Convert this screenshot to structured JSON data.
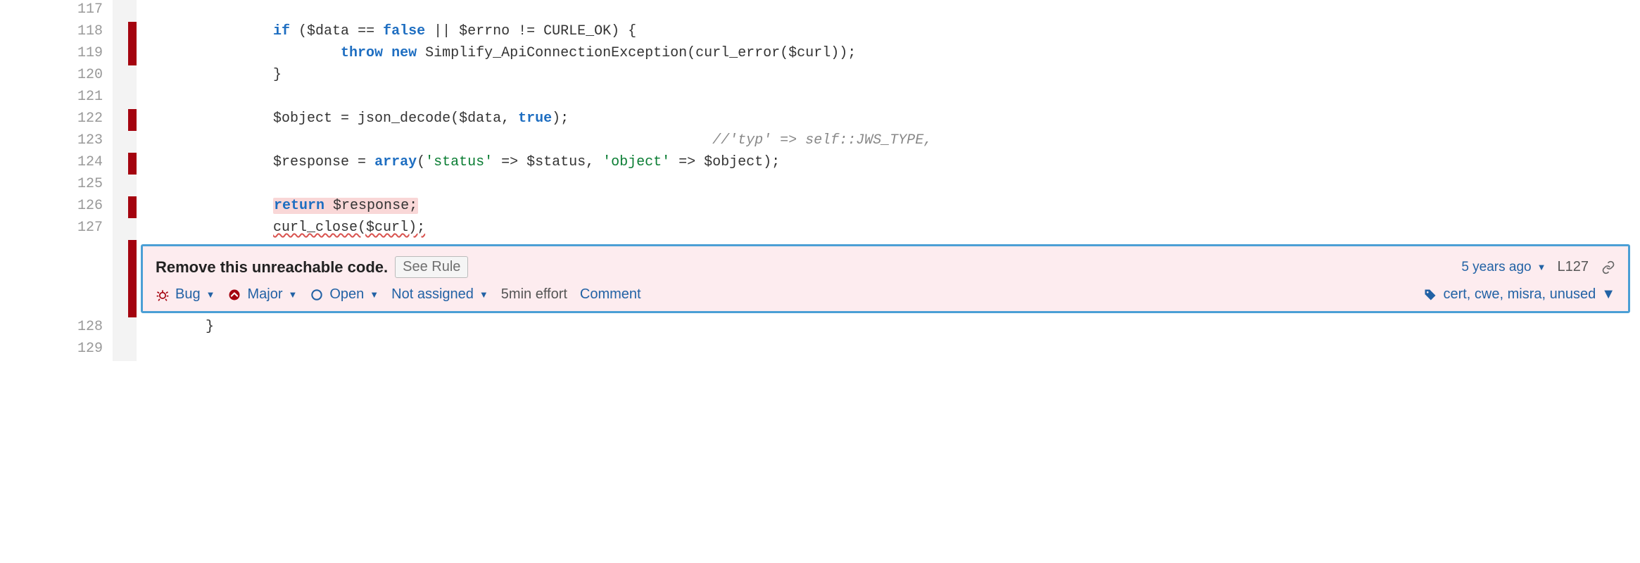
{
  "code_lines": [
    {
      "no": "117",
      "marker": false,
      "html": ""
    },
    {
      "no": "118",
      "marker": true,
      "html": "                <span class='kw'>if</span> ($data == <span class='kw'>false</span> || $errno != CURLE_OK) {"
    },
    {
      "no": "119",
      "marker": true,
      "html": "                        <span class='kw'>throw</span> <span class='kw'>new</span> Simplify_ApiConnectionException(curl_error($curl));"
    },
    {
      "no": "120",
      "marker": false,
      "html": "                }"
    },
    {
      "no": "121",
      "marker": false,
      "html": ""
    },
    {
      "no": "122",
      "marker": true,
      "html": "                $object = json_decode($data, <span class='kw'>true</span>);"
    },
    {
      "no": "123",
      "marker": false,
      "html": "                                                                    <span class='comment'>//'typ' =&gt; self::JWS_TYPE,</span>"
    },
    {
      "no": "124",
      "marker": true,
      "html": "                $response = <span class='kw'>array</span>(<span class='str'>'status'</span> =&gt; $status, <span class='str'>'object'</span> =&gt; $object);"
    },
    {
      "no": "125",
      "marker": false,
      "html": ""
    },
    {
      "no": "126",
      "marker": true,
      "html": "                <span class='hl-return'><span class='kw'>return</span> $response;</span>"
    },
    {
      "no": "127",
      "marker": false,
      "html": "                <span class='squiggle'>curl_close($curl);</span>"
    }
  ],
  "tail_lines": [
    {
      "no": "128",
      "marker": false,
      "html": "        }"
    },
    {
      "no": "129",
      "marker": false,
      "html": ""
    }
  ],
  "issue": {
    "title": "Remove this unreachable code.",
    "see_rule_label": "See Rule",
    "age": "5 years ago",
    "line_ref": "L127",
    "type": "Bug",
    "severity": "Major",
    "status": "Open",
    "assignee": "Not assigned",
    "effort": "5min effort",
    "comment_label": "Comment",
    "tags": "cert, cwe, misra, unused"
  }
}
